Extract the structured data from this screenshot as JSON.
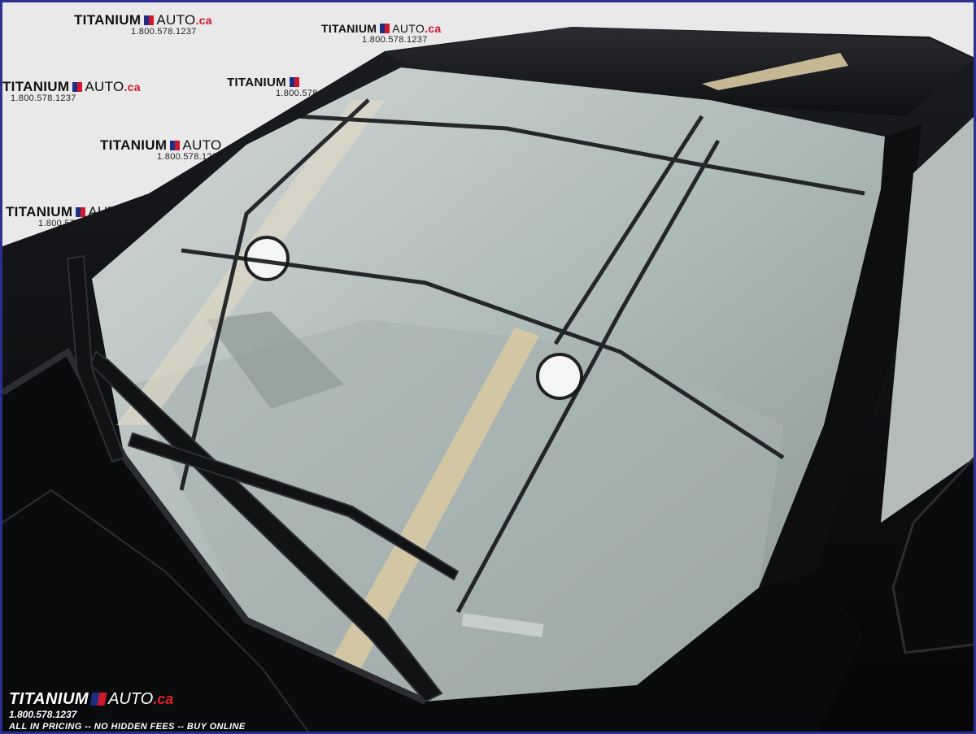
{
  "watermark": {
    "brand": "TITANIUM",
    "auto": "AUTO",
    "ca": ".ca",
    "phone": "1.800.578.1237"
  },
  "footer": {
    "brand": "TITANIUM",
    "auto": "AUTO",
    "ca": ".ca",
    "phone": "1.800.578.1237",
    "tagline": "ALL IN PRICING  -- NO HIDDEN FEES -- BUY ONLINE"
  },
  "colors": {
    "frame_border": "#2b2f8f",
    "car_body": "#0b0c0e",
    "glass": "#c9d3d0",
    "accent_red": "#d0182a",
    "accent_blue": "#1d2e86"
  }
}
